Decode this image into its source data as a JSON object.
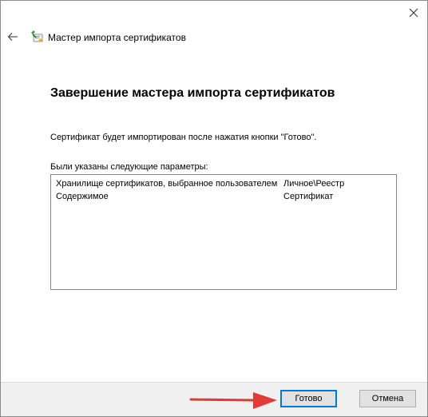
{
  "window": {
    "title": "Мастер импорта сертификатов"
  },
  "page": {
    "heading": "Завершение мастера импорта сертификатов",
    "description": "Сертификат будет импортирован после нажатия кнопки \"Готово\".",
    "params_label": "Были указаны следующие параметры:",
    "params": [
      {
        "key": "Хранилище сертификатов, выбранное пользователем",
        "value": "Личное\\Реестр"
      },
      {
        "key": "Содержимое",
        "value": "Сертификат"
      }
    ]
  },
  "footer": {
    "finish_label": "Готово",
    "cancel_label": "Отмена"
  },
  "colors": {
    "accent": "#0078d7",
    "annotation_arrow": "#e53935"
  },
  "icons": {
    "close": "close-icon",
    "back": "back-arrow-icon",
    "app": "certificate-wizard-icon"
  }
}
